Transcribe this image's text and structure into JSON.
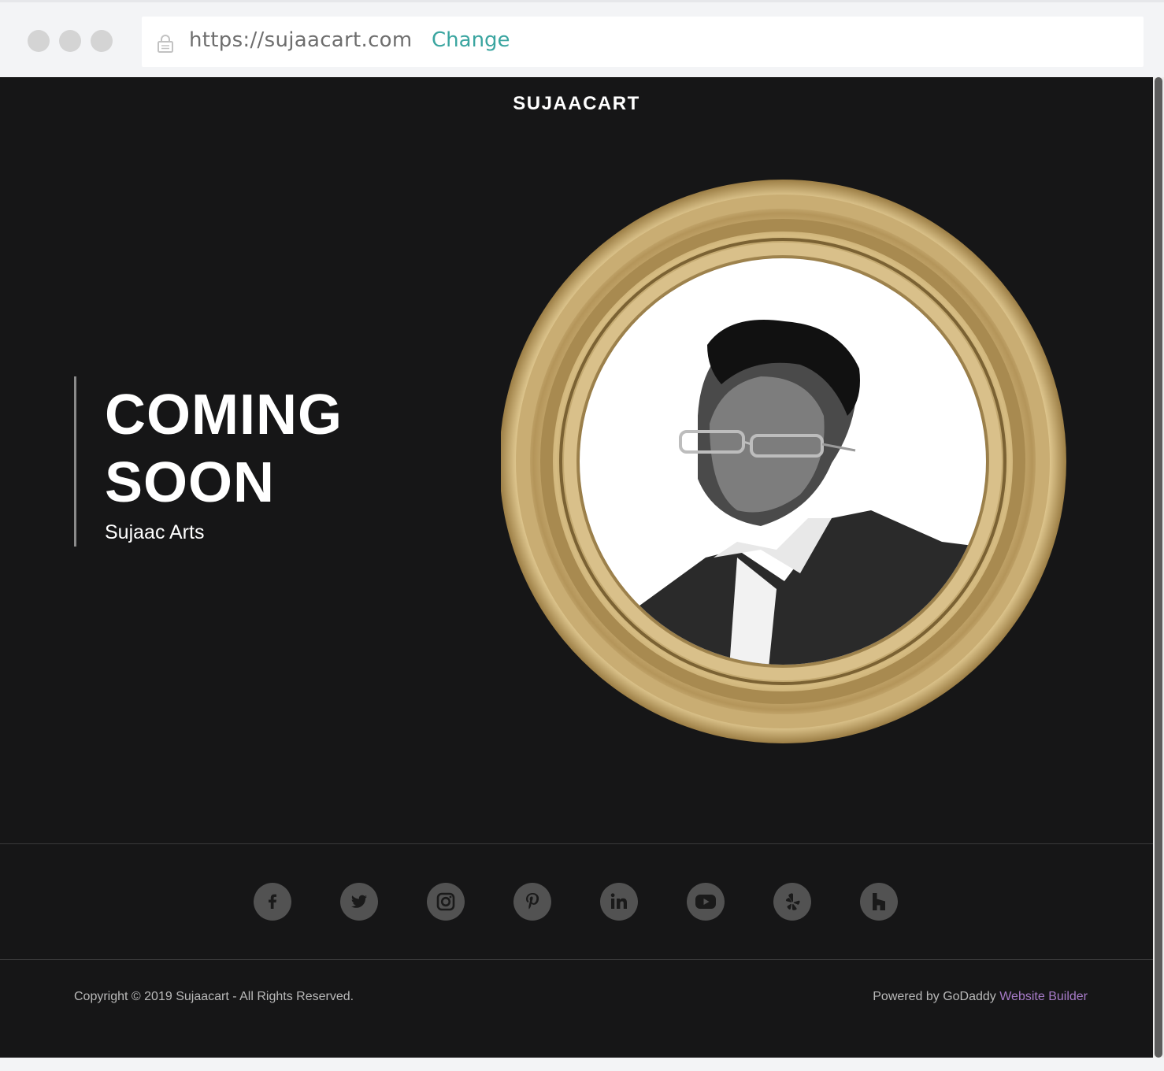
{
  "browser": {
    "url": "https://sujaacart.com",
    "change_label": "Change",
    "window_controls": [
      "close",
      "minimize",
      "maximize"
    ]
  },
  "site": {
    "title": "SUJAACART"
  },
  "hero": {
    "heading_line1": "COMING",
    "heading_line2": "SOON",
    "subtitle": "Sujaac Arts"
  },
  "social": {
    "icons": [
      "facebook-icon",
      "twitter-icon",
      "instagram-icon",
      "pinterest-icon",
      "linkedin-icon",
      "youtube-icon",
      "yelp-icon",
      "houzz-icon"
    ]
  },
  "footer": {
    "copyright": "Copyright © 2019 Sujaacart - All Rights Reserved.",
    "powered_prefix": "Powered by GoDaddy ",
    "powered_link": "Website Builder"
  },
  "colors": {
    "page_background": "#161617",
    "accent_link": "#3aa5a0",
    "builder_link": "#a77bc8",
    "frame_gold": "#b99a5a",
    "social_icon_bg": "#525252"
  }
}
